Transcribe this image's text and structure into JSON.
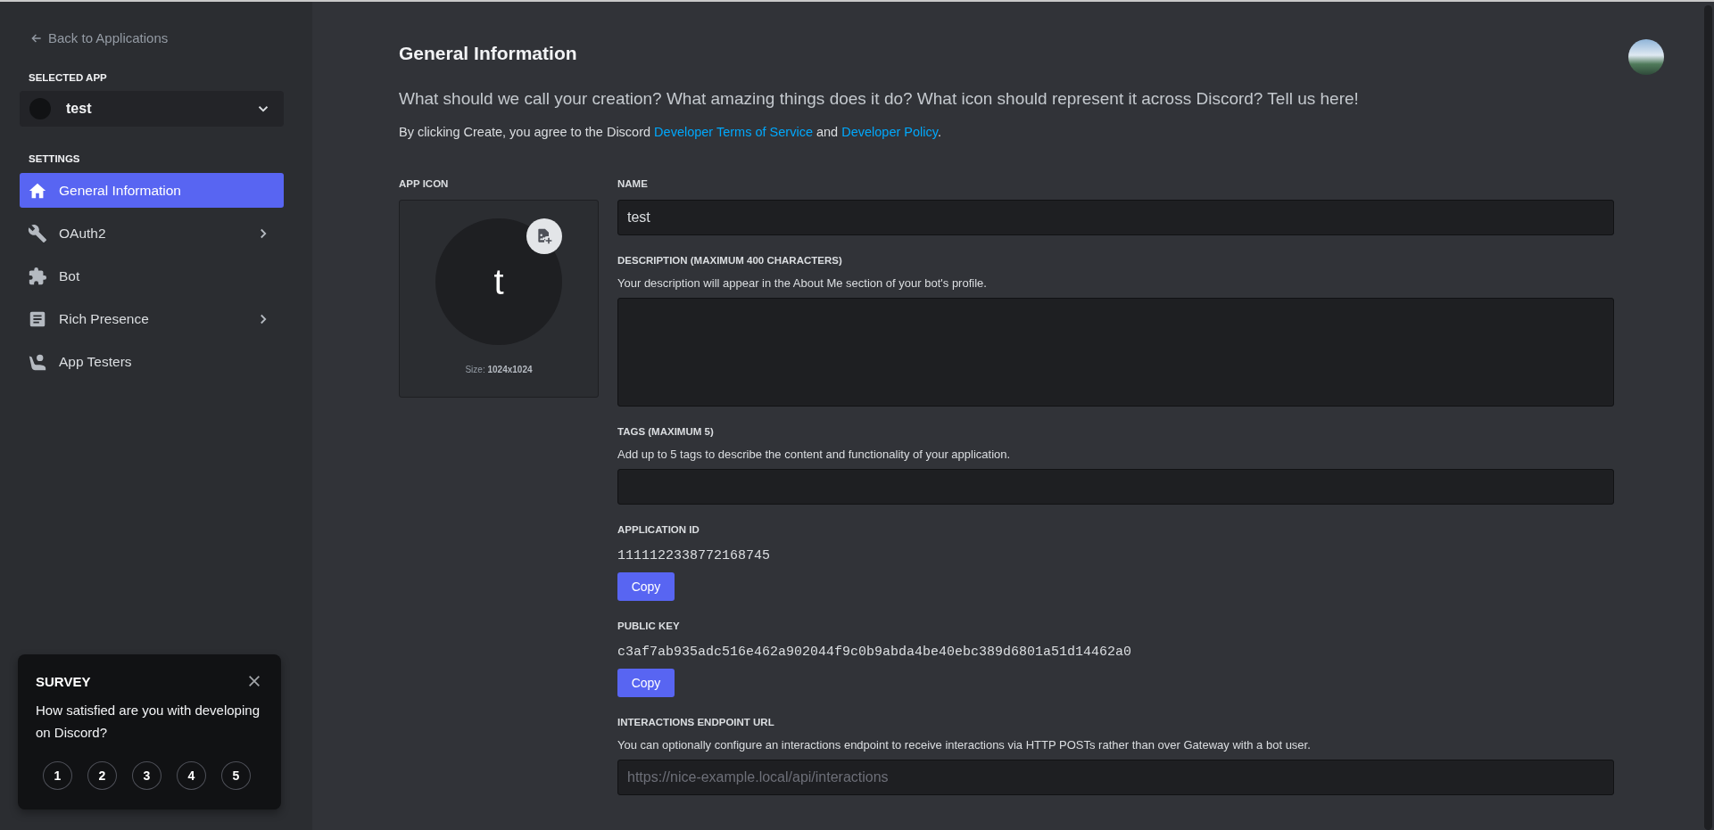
{
  "sidebar": {
    "back_link": "Back to Applications",
    "selected_app_label": "SELECTED APP",
    "selected_app": {
      "name": "test"
    },
    "settings_label": "SETTINGS",
    "nav_items": [
      {
        "label": "General Information",
        "selected": true,
        "expandable": false
      },
      {
        "label": "OAuth2",
        "selected": false,
        "expandable": true
      },
      {
        "label": "Bot",
        "selected": false,
        "expandable": false
      },
      {
        "label": "Rich Presence",
        "selected": false,
        "expandable": true
      },
      {
        "label": "App Testers",
        "selected": false,
        "expandable": false
      }
    ]
  },
  "survey": {
    "title": "SURVEY",
    "question": "How satisfied are you with developing on Discord?",
    "options": [
      "1",
      "2",
      "3",
      "4",
      "5"
    ]
  },
  "page": {
    "title": "General Information",
    "subtitle": "What should we call your creation? What amazing things does it do? What icon should represent it across Discord? Tell us here!",
    "agreement": {
      "before": "By clicking Create, you agree to the Discord",
      "link_1": "Developer Terms of Service",
      "between": "and",
      "link_2": "Developer Policy",
      "after": "."
    }
  },
  "app_icon": {
    "label": "APP ICON",
    "letter": "t",
    "size_label": "Size:",
    "size_value": "1024x1024"
  },
  "fields": [
    {
      "kind": "input",
      "label": "NAME",
      "value": "test"
    },
    {
      "kind": "textarea",
      "label": "DESCRIPTION (MAXIMUM 400 CHARACTERS)",
      "help": "Your description will appear in the About Me section of your bot's profile."
    },
    {
      "kind": "input",
      "label": "TAGS (MAXIMUM 5)",
      "help": "Add up to 5 tags to describe the content and functionality of your application."
    },
    {
      "kind": "copy",
      "label": "APPLICATION ID",
      "value": "1111122338772168745",
      "button": "Copy"
    },
    {
      "kind": "copy",
      "label": "PUBLIC KEY",
      "value": "c3af7ab935adc516e462a902044f9c0b9abda4be40ebc389d6801a51d14462a0",
      "button": "Copy"
    },
    {
      "kind": "input",
      "label": "INTERACTIONS ENDPOINT URL",
      "help": "You can optionally configure an interactions endpoint to receive interactions via HTTP POSTs rather than over Gateway with a bot user.",
      "placeholder": "https://nice-example.local/api/interactions"
    }
  ]
}
